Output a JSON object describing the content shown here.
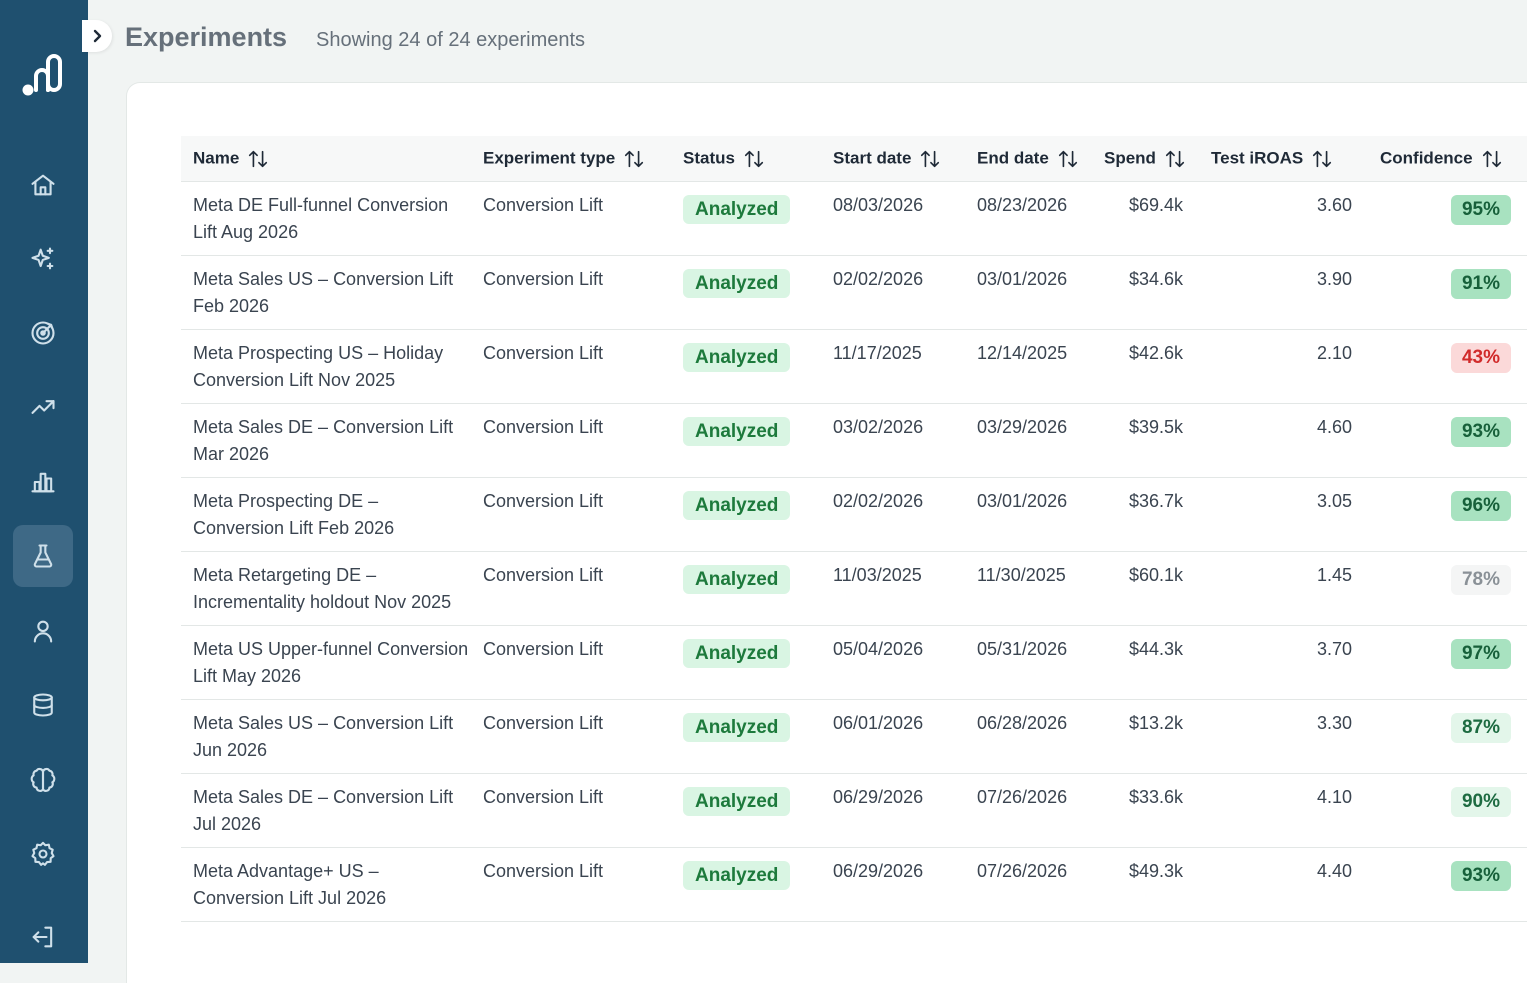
{
  "header": {
    "title": "Experiments",
    "subtitle": "Showing 24 of 24 experiments"
  },
  "sidebar": {
    "items": [
      {
        "icon": "home-icon",
        "name": "nav-home"
      },
      {
        "icon": "sparkles-icon",
        "name": "nav-insights"
      },
      {
        "icon": "target-icon",
        "name": "nav-goals"
      },
      {
        "icon": "trend-up-icon",
        "name": "nav-trends"
      },
      {
        "icon": "bar-chart-icon",
        "name": "nav-reports"
      },
      {
        "icon": "flask-icon",
        "name": "nav-experiments",
        "active": true
      },
      {
        "icon": "user-icon",
        "name": "nav-users"
      },
      {
        "icon": "database-icon",
        "name": "nav-data"
      },
      {
        "icon": "brain-icon",
        "name": "nav-models"
      },
      {
        "icon": "gear-icon",
        "name": "nav-settings"
      },
      {
        "icon": "logout-icon",
        "name": "nav-logout"
      }
    ]
  },
  "table": {
    "columns": [
      "Name",
      "Experiment type",
      "Status",
      "Start date",
      "End date",
      "Spend",
      "Test iROAS",
      "Confidence"
    ],
    "rows": [
      {
        "name": "Meta DE Full-funnel Conversion Lift Aug 2026",
        "type": "Conversion Lift",
        "status": "Analyzed",
        "start": "08/03/2026",
        "end": "08/23/2026",
        "spend": "$69.4k",
        "iroas": "3.60",
        "confidence": "95%",
        "conf_level": "high"
      },
      {
        "name": "Meta Sales US – Conversion Lift Feb 2026",
        "type": "Conversion Lift",
        "status": "Analyzed",
        "start": "02/02/2026",
        "end": "03/01/2026",
        "spend": "$34.6k",
        "iroas": "3.90",
        "confidence": "91%",
        "conf_level": "high"
      },
      {
        "name": "Meta Prospecting US – Holiday Conversion Lift Nov 2025",
        "type": "Conversion Lift",
        "status": "Analyzed",
        "start": "11/17/2025",
        "end": "12/14/2025",
        "spend": "$42.6k",
        "iroas": "2.10",
        "confidence": "43%",
        "conf_level": "low"
      },
      {
        "name": "Meta Sales DE – Conversion Lift Mar 2026",
        "type": "Conversion Lift",
        "status": "Analyzed",
        "start": "03/02/2026",
        "end": "03/29/2026",
        "spend": "$39.5k",
        "iroas": "4.60",
        "confidence": "93%",
        "conf_level": "high"
      },
      {
        "name": "Meta Prospecting DE – Conversion Lift Feb 2026",
        "type": "Conversion Lift",
        "status": "Analyzed",
        "start": "02/02/2026",
        "end": "03/01/2026",
        "spend": "$36.7k",
        "iroas": "3.05",
        "confidence": "96%",
        "conf_level": "high"
      },
      {
        "name": "Meta Retargeting DE – Incrementality holdout Nov 2025",
        "type": "Conversion Lift",
        "status": "Analyzed",
        "start": "11/03/2025",
        "end": "11/30/2025",
        "spend": "$60.1k",
        "iroas": "1.45",
        "confidence": "78%",
        "conf_level": "neutral"
      },
      {
        "name": "Meta US Upper-funnel Conversion Lift May 2026",
        "type": "Conversion Lift",
        "status": "Analyzed",
        "start": "05/04/2026",
        "end": "05/31/2026",
        "spend": "$44.3k",
        "iroas": "3.70",
        "confidence": "97%",
        "conf_level": "high"
      },
      {
        "name": "Meta Sales US – Conversion Lift Jun 2026",
        "type": "Conversion Lift",
        "status": "Analyzed",
        "start": "06/01/2026",
        "end": "06/28/2026",
        "spend": "$13.2k",
        "iroas": "3.30",
        "confidence": "87%",
        "conf_level": "medium"
      },
      {
        "name": "Meta Sales DE – Conversion Lift Jul 2026",
        "type": "Conversion Lift",
        "status": "Analyzed",
        "start": "06/29/2026",
        "end": "07/26/2026",
        "spend": "$33.6k",
        "iroas": "4.10",
        "confidence": "90%",
        "conf_level": "medium"
      },
      {
        "name": "Meta Advantage+ US – Conversion Lift Jul 2026",
        "type": "Conversion Lift",
        "status": "Analyzed",
        "start": "06/29/2026",
        "end": "07/26/2026",
        "spend": "$49.3k",
        "iroas": "4.40",
        "confidence": "93%",
        "conf_level": "high"
      }
    ]
  },
  "colors": {
    "sidebar": "#1f506f",
    "status_bg": "#d9f5e3",
    "status_text": "#1d7a3c",
    "conf_high_bg": "#a8e2c0",
    "conf_high_text": "#17603a",
    "conf_medium_bg": "#e3f6ea",
    "conf_medium_text": "#1d6b41",
    "conf_low_bg": "#fbd9d9",
    "conf_low_text": "#d12b2b",
    "conf_neutral_bg": "#f4f5f5",
    "conf_neutral_text": "#8a9197"
  }
}
